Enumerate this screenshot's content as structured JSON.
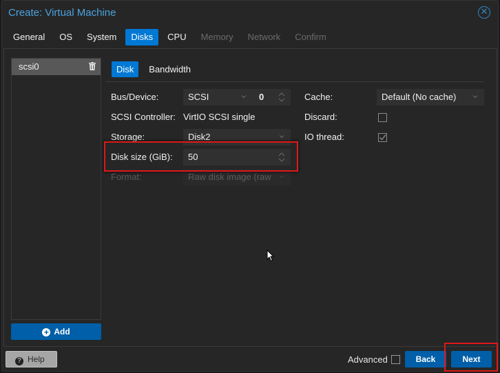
{
  "window": {
    "title": "Create: Virtual Machine"
  },
  "tabs": [
    {
      "label": "General",
      "state": "normal"
    },
    {
      "label": "OS",
      "state": "normal"
    },
    {
      "label": "System",
      "state": "normal"
    },
    {
      "label": "Disks",
      "state": "active"
    },
    {
      "label": "CPU",
      "state": "normal"
    },
    {
      "label": "Memory",
      "state": "disabled"
    },
    {
      "label": "Network",
      "state": "disabled"
    },
    {
      "label": "Confirm",
      "state": "disabled"
    }
  ],
  "disks": {
    "items": [
      {
        "label": "scsi0",
        "icon": "trash-icon"
      }
    ],
    "add_label": "Add"
  },
  "subtabs": [
    {
      "label": "Disk",
      "active": true
    },
    {
      "label": "Bandwidth",
      "active": false
    }
  ],
  "form": {
    "bus_device": {
      "label": "Bus/Device:",
      "value": "SCSI",
      "index": "0"
    },
    "scsi_controller": {
      "label": "SCSI Controller:",
      "value": "VirtIO SCSI single"
    },
    "storage": {
      "label": "Storage:",
      "value": "Disk2"
    },
    "disk_size": {
      "label": "Disk size (GiB):",
      "value": "50"
    },
    "format": {
      "label": "Format:",
      "value": "Raw disk image (raw"
    },
    "cache": {
      "label": "Cache:",
      "value": "Default (No cache)"
    },
    "discard": {
      "label": "Discard:",
      "checked": false
    },
    "io_thread": {
      "label": "IO thread:",
      "checked": true
    }
  },
  "footer": {
    "help_label": "Help",
    "advanced_label": "Advanced",
    "advanced_checked": false,
    "back_label": "Back",
    "next_label": "Next"
  },
  "colors": {
    "accent": "#0078d4",
    "button": "#005fa8",
    "title": "#4aa3df",
    "highlight": "#e01818"
  }
}
